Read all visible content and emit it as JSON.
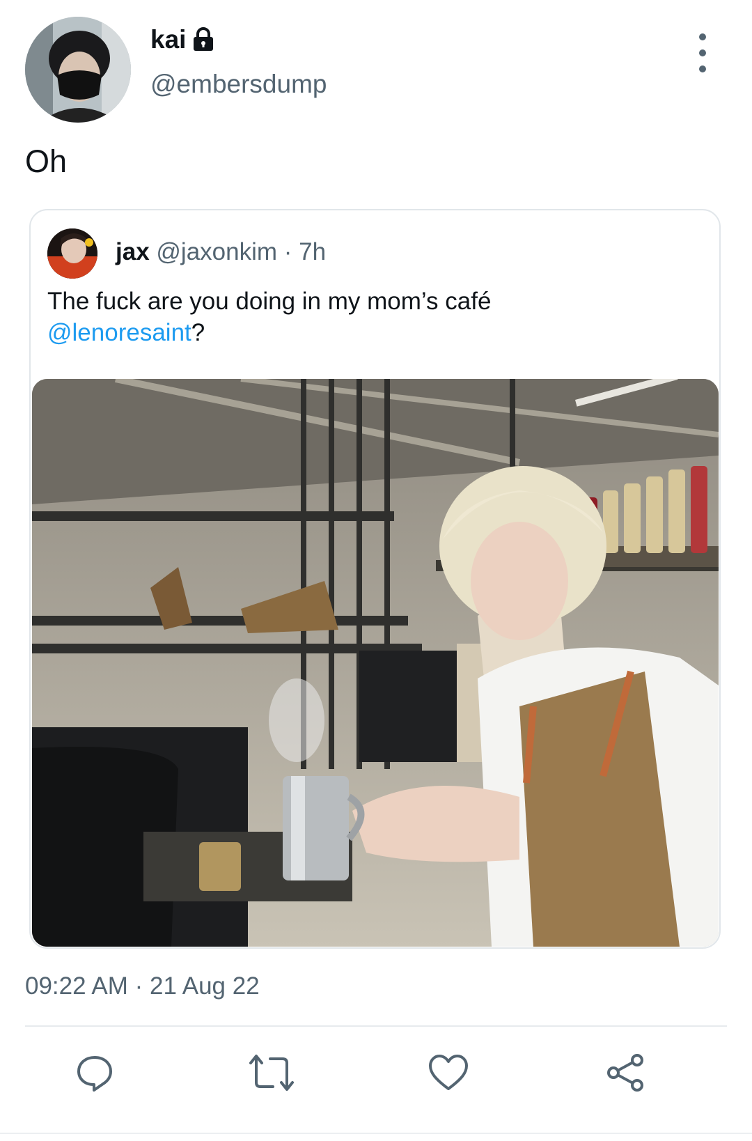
{
  "author": {
    "display_name": "kai",
    "handle": "@embersdump",
    "locked": true
  },
  "tweet": {
    "text": "Oh"
  },
  "quoted_tweet": {
    "display_name": "jax",
    "handle": "@jaxonkim",
    "separator": "·",
    "age": "7h",
    "text_before": "The fuck are you doing in my mom’s café",
    "mention": "@lenoresaint",
    "text_after": "?"
  },
  "meta": {
    "time": "09:22 AM",
    "separator": "·",
    "date": "21 Aug 22"
  },
  "actions": [
    {
      "icon": "reply-icon"
    },
    {
      "icon": "retweet-icon"
    },
    {
      "icon": "like-icon"
    },
    {
      "icon": "share-icon"
    }
  ],
  "colors": {
    "text": "#0f1419",
    "secondary": "#536471",
    "link": "#1d9bf0",
    "border": "#e1e6ea"
  }
}
